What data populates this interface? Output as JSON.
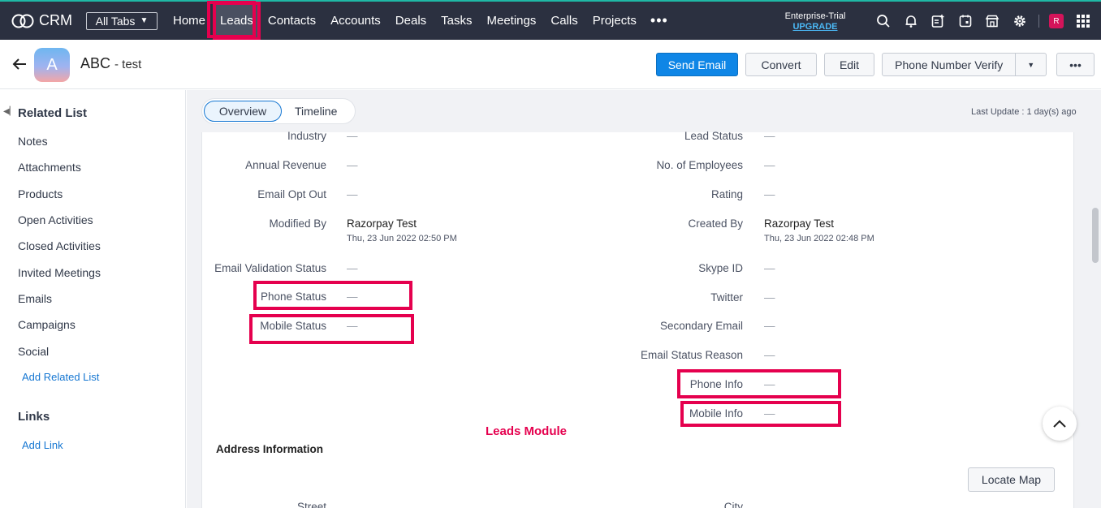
{
  "nav": {
    "logo": "CRM",
    "all_tabs": "All Tabs",
    "tabs": [
      "Home",
      "Leads",
      "Contacts",
      "Accounts",
      "Deals",
      "Tasks",
      "Meetings",
      "Calls",
      "Projects"
    ],
    "more": "•••",
    "trial_label": "Enterprise-Trial",
    "upgrade": "UPGRADE",
    "avatar_initial": "R",
    "icons": [
      "search-icon",
      "bell-icon",
      "add-note-icon",
      "calendar-icon",
      "marketplace-icon",
      "gear-icon",
      "apps-grid-icon"
    ]
  },
  "record": {
    "avatar_initial": "A",
    "title": "ABC",
    "subtitle": "- test",
    "buttons": {
      "send_email": "Send Email",
      "convert": "Convert",
      "edit": "Edit",
      "phone_verify": "Phone Number Verify",
      "more": "•••"
    }
  },
  "sidebar": {
    "related_heading": "Related List",
    "items": [
      "Notes",
      "Attachments",
      "Products",
      "Open Activities",
      "Closed Activities",
      "Invited Meetings",
      "Emails",
      "Campaigns",
      "Social"
    ],
    "add_related": "Add Related List",
    "links_heading": "Links",
    "add_link": "Add Link"
  },
  "main": {
    "tab_overview": "Overview",
    "tab_timeline": "Timeline",
    "last_update": "Last Update : 1 day(s) ago",
    "left_fields": [
      {
        "label": "Industry",
        "value": "—"
      },
      {
        "label": "Annual Revenue",
        "value": "—"
      },
      {
        "label": "Email Opt Out",
        "value": "—"
      },
      {
        "label": "Modified By",
        "value": "Razorpay Test",
        "sub": "Thu, 23 Jun 2022 02:50 PM"
      },
      {
        "label": "Email Validation Status",
        "value": "—"
      },
      {
        "label": "Phone Status",
        "value": "—"
      },
      {
        "label": "Mobile Status",
        "value": "—"
      }
    ],
    "right_fields": [
      {
        "label": "Lead Status",
        "value": "—"
      },
      {
        "label": "No. of Employees",
        "value": "—"
      },
      {
        "label": "Rating",
        "value": "—"
      },
      {
        "label": "Created By",
        "value": "Razorpay Test",
        "sub": "Thu, 23 Jun 2022 02:48 PM"
      },
      {
        "label": "Skype ID",
        "value": "—"
      },
      {
        "label": "Twitter",
        "value": "—"
      },
      {
        "label": "Secondary Email",
        "value": "—"
      },
      {
        "label": "Email Status Reason",
        "value": "—"
      },
      {
        "label": "Phone Info",
        "value": "—"
      },
      {
        "label": "Mobile Info",
        "value": "—"
      }
    ],
    "annotation": "Leads Module",
    "address_heading": "Address Information",
    "locate_map": "Locate Map",
    "street": "Street",
    "city": "City"
  },
  "colors": {
    "nav_bg": "#2b3040",
    "highlight": "#e5004e",
    "primary": "#0f86e6",
    "link": "#1677d2"
  }
}
